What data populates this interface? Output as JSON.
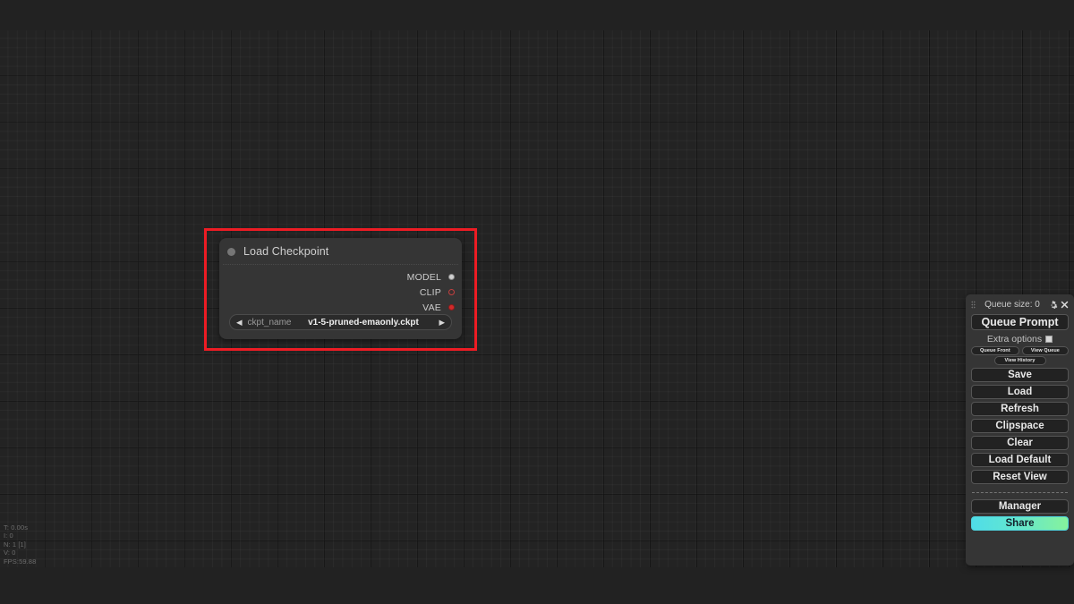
{
  "canvas": {
    "background_color": "#222222",
    "grid_color": "#232323"
  },
  "node": {
    "title": "Load Checkpoint",
    "title_dot_icon": "collapse-dot-icon",
    "selected": true,
    "selection_color": "#ed1c24",
    "outputs": [
      {
        "label": "MODEL",
        "dot_icon": "output-slot-model-icon",
        "color": "#cfcfcf"
      },
      {
        "label": "CLIP",
        "dot_icon": "output-slot-clip-icon",
        "color": "#c24040"
      },
      {
        "label": "VAE",
        "dot_icon": "output-slot-vae-icon",
        "color": "#d22a2a"
      }
    ],
    "widget": {
      "prev_icon": "arrow-left-icon",
      "next_icon": "arrow-right-icon",
      "name": "ckpt_name",
      "value": "v1-5-pruned-emaonly.ckpt"
    }
  },
  "stats": {
    "time": "T: 0.00s",
    "iterations": "I: 0",
    "nodes": "N: 1 [1]",
    "vertices": "V: 0",
    "fps": "FPS:59.88"
  },
  "menu": {
    "drag_handle_icon": "drag-grip-icon",
    "queue_size_label": "Queue size: 0",
    "settings_icon": "gear-icon",
    "close_icon": "close-icon",
    "queue_prompt_label": "Queue Prompt",
    "extra_options_label": "Extra options",
    "extra_options_checked": false,
    "small_buttons": [
      {
        "label": "Queue Front"
      },
      {
        "label": "View Queue"
      },
      {
        "label": "View History"
      }
    ],
    "main_buttons": [
      {
        "label": "Save"
      },
      {
        "label": "Load"
      },
      {
        "label": "Refresh"
      },
      {
        "label": "Clipspace"
      },
      {
        "label": "Clear"
      },
      {
        "label": "Load Default"
      },
      {
        "label": "Reset View"
      }
    ],
    "manager_label": "Manager",
    "share_label": "Share",
    "share_gradient_start": "#4fdde8",
    "share_gradient_end": "#86f29c"
  }
}
